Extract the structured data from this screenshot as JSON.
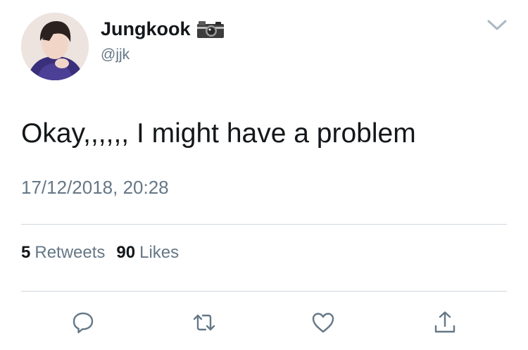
{
  "tweet": {
    "author": {
      "display_name": "Jungkook",
      "handle": "@jjk",
      "name_emoji_icon": "camera-icon"
    },
    "text": "Okay,,,,,, I might have a problem",
    "timestamp": "17/12/2018, 20:28",
    "stats": {
      "retweets_count": "5",
      "retweets_label": "Retweets",
      "likes_count": "90",
      "likes_label": "Likes"
    },
    "actions": [
      "reply-icon",
      "retweet-icon",
      "like-icon",
      "share-icon"
    ],
    "menu_icon": "chevron-down-icon"
  },
  "colors": {
    "text_primary": "#14171a",
    "text_secondary": "#657786",
    "divider": "#cfd6dc",
    "icon": "#657786"
  }
}
